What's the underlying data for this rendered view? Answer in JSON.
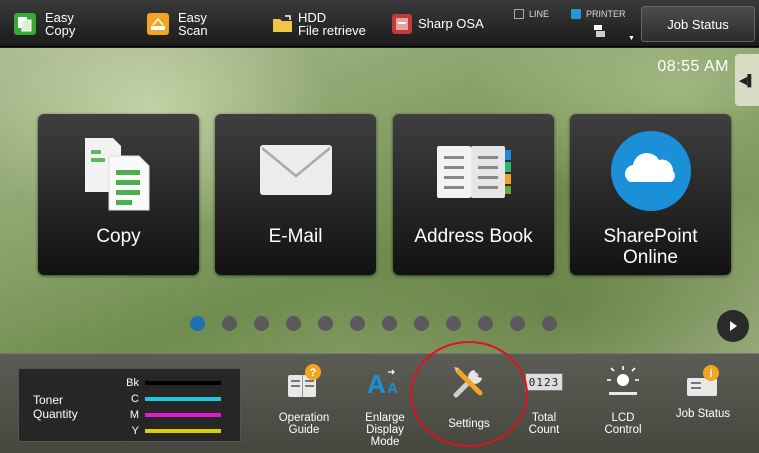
{
  "topbar": {
    "easy_copy": {
      "line1": "Easy",
      "line2": "Copy",
      "icon": "easy-copy-icon"
    },
    "easy_scan": {
      "line1": "Easy",
      "line2": "Scan",
      "icon": "easy-scan-icon"
    },
    "hdd": {
      "line1": "HDD",
      "line2": "File retrieve",
      "icon": "folder-icon"
    },
    "sharp_osa": {
      "label": "Sharp OSA",
      "icon": "sharp-osa-icon"
    },
    "line_status": "LINE",
    "printer_status": "PRINTER",
    "job_status": "Job Status"
  },
  "main": {
    "clock": "08:55 AM",
    "tiles": [
      {
        "label": "Copy",
        "icon": "copy-icon"
      },
      {
        "label": "E-Mail",
        "icon": "envelope-icon"
      },
      {
        "label": "Address Book",
        "icon": "address-book-icon"
      },
      {
        "label": "SharePoint",
        "label2": "Online",
        "icon": "cloud-icon"
      }
    ],
    "page_count": 12,
    "active_page": 1
  },
  "bottombar": {
    "toner": {
      "label1": "Toner",
      "label2": "Quantity",
      "colors": [
        {
          "code": "Bk",
          "color": "#000000"
        },
        {
          "code": "C",
          "color": "#1ec8dc"
        },
        {
          "code": "M",
          "color": "#e11ad2"
        },
        {
          "code": "Y",
          "color": "#d8d200"
        }
      ]
    },
    "items": [
      {
        "line1": "Operation",
        "line2": "Guide",
        "line3": "",
        "icon": "operation-guide-icon"
      },
      {
        "line1": "Enlarge",
        "line2": "Display",
        "line3": "Mode",
        "icon": "enlarge-display-icon"
      },
      {
        "line1": "Settings",
        "line2": "",
        "line3": "",
        "icon": "settings-icon"
      },
      {
        "line1": "Total",
        "line2": "Count",
        "line3": "",
        "icon": "counter-icon"
      },
      {
        "line1": "LCD",
        "line2": "Control",
        "line3": "",
        "icon": "brightness-icon"
      },
      {
        "line1": "Job Status",
        "line2": "",
        "line3": "",
        "icon": "job-status-icon"
      }
    ],
    "counter_digits": "0123"
  },
  "colors": {
    "accent_blue": "#1f6fb5",
    "highlight_red": "#e0121b"
  }
}
